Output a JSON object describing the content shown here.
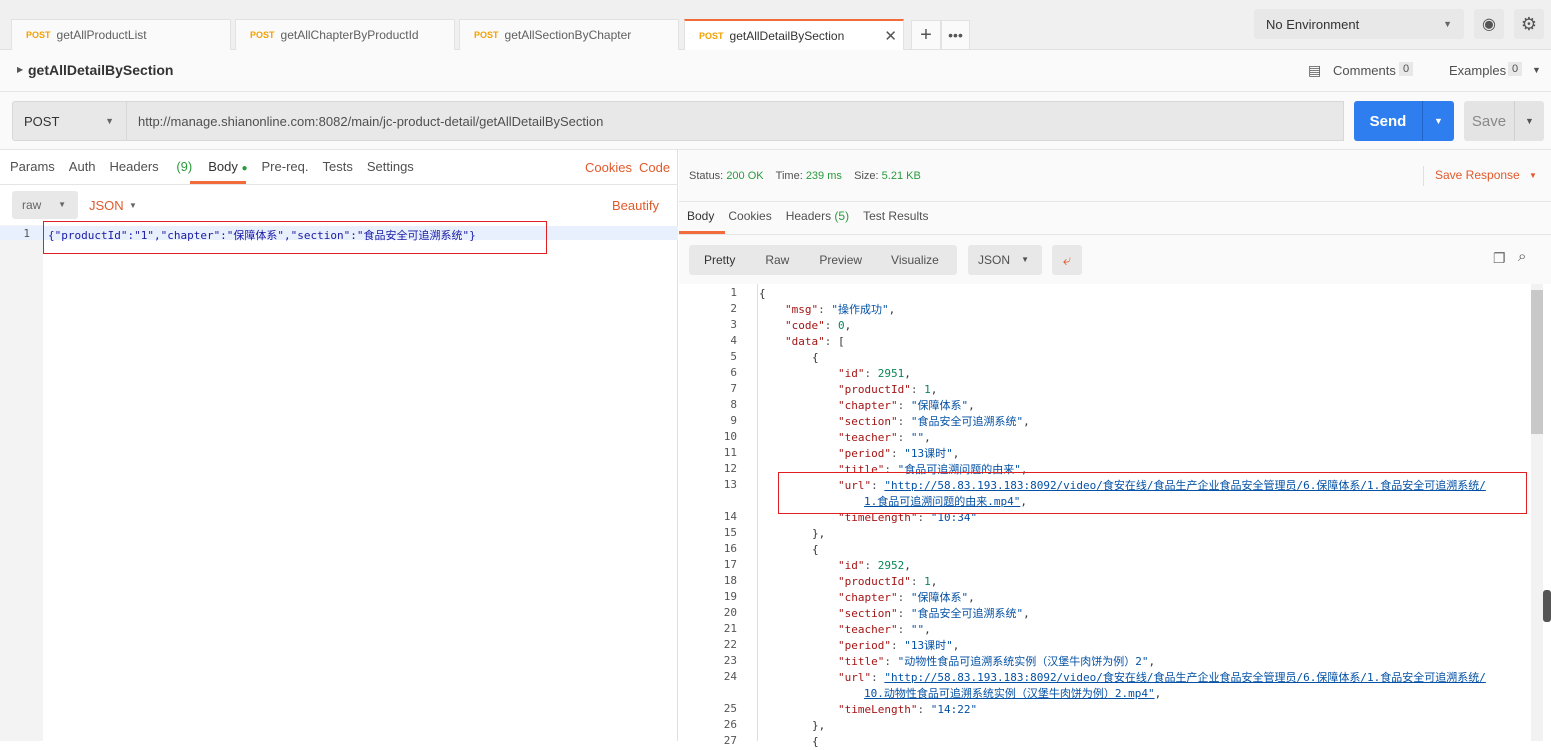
{
  "request_tabs": [
    {
      "method": "POST",
      "name": "getAllProductList"
    },
    {
      "method": "POST",
      "name": "getAllChapterByProductId"
    },
    {
      "method": "POST",
      "name": "getAllSectionByChapter"
    },
    {
      "method": "POST",
      "name": "getAllDetailBySection",
      "active": true
    }
  ],
  "environment": "No Environment",
  "request": {
    "title": "getAllDetailBySection",
    "comments_label": "Comments",
    "comments_count": "0",
    "examples_label": "Examples",
    "examples_count": "0",
    "method": "POST",
    "url": "http://manage.shianonline.com:8082/main/jc-product-detail/getAllDetailBySection",
    "send_label": "Send",
    "save_label": "Save"
  },
  "req_tabs": {
    "params": "Params",
    "auth": "Auth",
    "headers": "Headers",
    "headers_count": "(9)",
    "body": "Body",
    "prereq": "Pre-req.",
    "tests": "Tests",
    "settings": "Settings",
    "cookies": "Cookies",
    "code": "Code"
  },
  "body_mode": {
    "mode": "raw",
    "type": "JSON",
    "beautify": "Beautify"
  },
  "request_body": {
    "line": "1",
    "text": "{\"productId\":\"1\",\"chapter\":\"保障体系\",\"section\":\"食品安全可追溯系统\"}"
  },
  "response": {
    "status_label": "Status:",
    "status": "200 OK",
    "time_label": "Time:",
    "time": "239 ms",
    "size_label": "Size:",
    "size": "5.21 KB",
    "save_response": "Save Response",
    "tabs": {
      "body": "Body",
      "cookies": "Cookies",
      "headers": "Headers",
      "headers_count": "(5)",
      "tests": "Test Results"
    },
    "views": [
      "Pretty",
      "Raw",
      "Preview",
      "Visualize"
    ],
    "format": "JSON",
    "lines": [
      {
        "n": "1",
        "i": 0,
        "p": "{"
      },
      {
        "n": "2",
        "i": 1,
        "k": "\"msg\"",
        "s": "\"操作成功\"",
        "p": ","
      },
      {
        "n": "3",
        "i": 1,
        "k": "\"code\"",
        "num": "0",
        "p": ","
      },
      {
        "n": "4",
        "i": 1,
        "k": "\"data\"",
        "p": "["
      },
      {
        "n": "5",
        "i": 2,
        "p": "{"
      },
      {
        "n": "6",
        "i": 3,
        "k": "\"id\"",
        "num": "2951",
        "p": ","
      },
      {
        "n": "7",
        "i": 3,
        "k": "\"productId\"",
        "num": "1",
        "p": ","
      },
      {
        "n": "8",
        "i": 3,
        "k": "\"chapter\"",
        "s": "\"保障体系\"",
        "p": ","
      },
      {
        "n": "9",
        "i": 3,
        "k": "\"section\"",
        "s": "\"食品安全可追溯系统\"",
        "p": ","
      },
      {
        "n": "10",
        "i": 3,
        "k": "\"teacher\"",
        "s": "\"\"",
        "p": ","
      },
      {
        "n": "11",
        "i": 3,
        "k": "\"period\"",
        "s": "\"13课时\"",
        "p": ","
      },
      {
        "n": "12",
        "i": 3,
        "k": "\"title\"",
        "s": "\"食品可追溯问题的由来\"",
        "p": ","
      },
      {
        "n": "13",
        "i": 3,
        "k": "\"url\"",
        "u": "\"http://58.83.193.183:8092/video/食安在线/食品生产企业食品安全管理员/6.保障体系/1.食品安全可追溯系统/",
        "u2": "1.食品可追溯问题的由来.mp4\"",
        "p": ","
      },
      {
        "n": "14",
        "i": 3,
        "k": "\"timeLength\"",
        "s": "\"10:34\""
      },
      {
        "n": "15",
        "i": 2,
        "p": "},"
      },
      {
        "n": "16",
        "i": 2,
        "p": "{"
      },
      {
        "n": "17",
        "i": 3,
        "k": "\"id\"",
        "num": "2952",
        "p": ","
      },
      {
        "n": "18",
        "i": 3,
        "k": "\"productId\"",
        "num": "1",
        "p": ","
      },
      {
        "n": "19",
        "i": 3,
        "k": "\"chapter\"",
        "s": "\"保障体系\"",
        "p": ","
      },
      {
        "n": "20",
        "i": 3,
        "k": "\"section\"",
        "s": "\"食品安全可追溯系统\"",
        "p": ","
      },
      {
        "n": "21",
        "i": 3,
        "k": "\"teacher\"",
        "s": "\"\"",
        "p": ","
      },
      {
        "n": "22",
        "i": 3,
        "k": "\"period\"",
        "s": "\"13课时\"",
        "p": ","
      },
      {
        "n": "23",
        "i": 3,
        "k": "\"title\"",
        "s": "\"动物性食品可追溯系统实例（汉堡牛肉饼为例）2\"",
        "p": ","
      },
      {
        "n": "24",
        "i": 3,
        "k": "\"url\"",
        "u": "\"http://58.83.193.183:8092/video/食安在线/食品生产企业食品安全管理员/6.保障体系/1.食品安全可追溯系统/",
        "u2": "10.动物性食品可追溯系统实例（汉堡牛肉饼为例）2.mp4\"",
        "p": ","
      },
      {
        "n": "25",
        "i": 3,
        "k": "\"timeLength\"",
        "s": "\"14:22\""
      },
      {
        "n": "26",
        "i": 2,
        "p": "},"
      },
      {
        "n": "27",
        "i": 2,
        "p": "{"
      }
    ]
  },
  "colors": {
    "accent": "#f26b3a",
    "send": "#2f7ef0",
    "highlight_box": "#e02020"
  }
}
